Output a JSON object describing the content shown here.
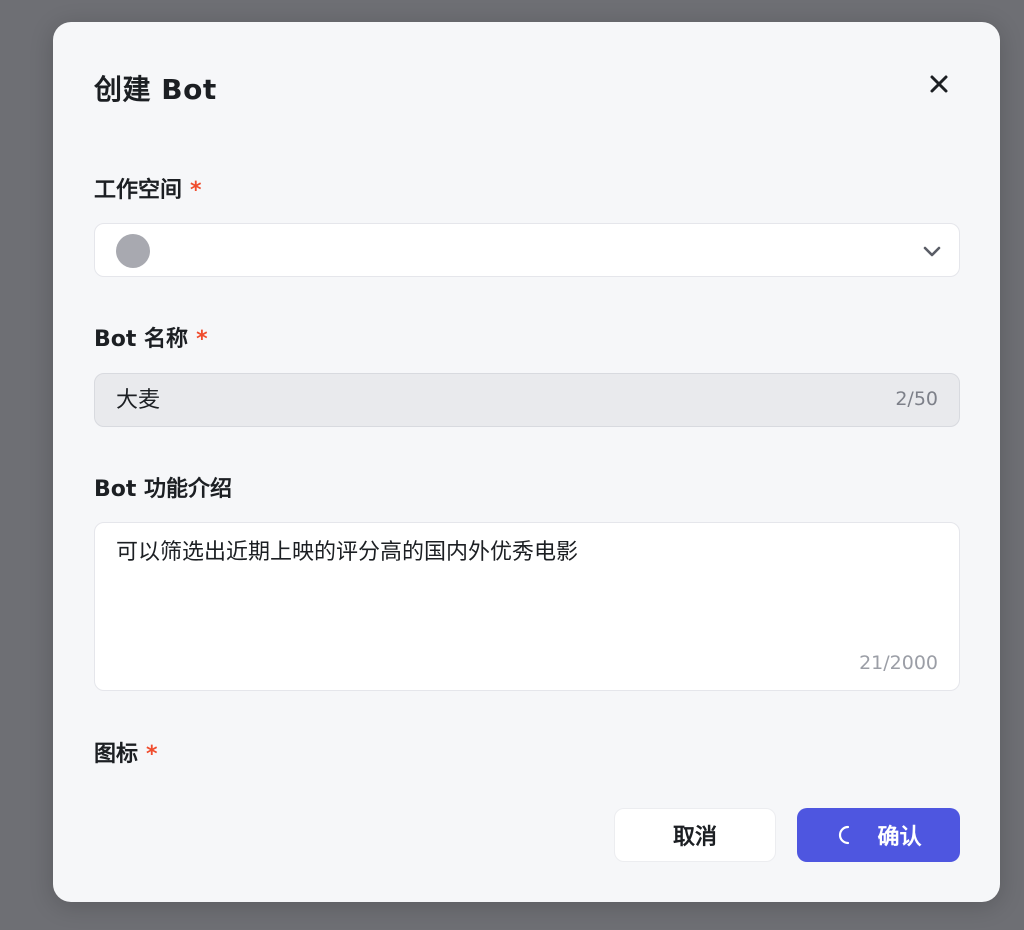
{
  "dialog": {
    "title": "创建 Bot",
    "close_icon": "close-icon"
  },
  "workspace": {
    "label": "工作空间",
    "required_mark": "*",
    "avatar_icon": "avatar-placeholder",
    "chevron_icon": "chevron-down-icon"
  },
  "bot_name": {
    "label": "Bot 名称",
    "required_mark": "*",
    "value": "大麦",
    "counter": "2/50"
  },
  "bot_description": {
    "label": "Bot 功能介绍",
    "value": "可以筛选出近期上映的评分高的国内外优秀电影",
    "counter": "21/2000"
  },
  "icon_field": {
    "label": "图标",
    "required_mark": "*"
  },
  "footer": {
    "cancel_label": "取消",
    "confirm_label": "确认",
    "loading_icon": "loading-spinner-icon"
  },
  "colors": {
    "primary": "#4e56e0",
    "required": "#f04c2d",
    "overlay": "#6e6f74",
    "dialog_bg": "#f6f7f9"
  }
}
